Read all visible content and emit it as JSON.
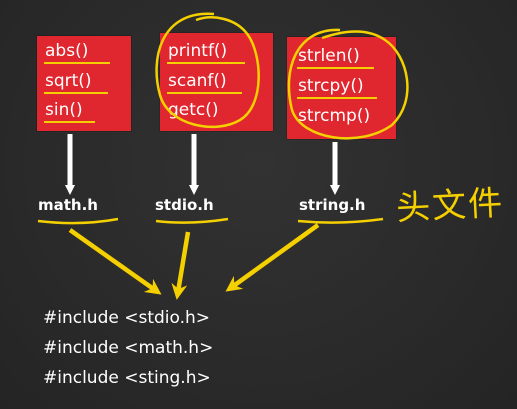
{
  "boxes": [
    {
      "functions": [
        "abs()",
        "sqrt()",
        "sin()"
      ],
      "header": "math.h"
    },
    {
      "functions": [
        "printf()",
        "scanf()",
        "getc()"
      ],
      "header": "stdio.h"
    },
    {
      "functions": [
        "strlen()",
        "strcpy()",
        "strcmp()"
      ],
      "header": "string.h"
    }
  ],
  "handwritten_note": "头文件",
  "includes": [
    "#include <stdio.h>",
    "#include <math.h>",
    "#include <sting.h>"
  ],
  "colors": {
    "background": "#2b2b2b",
    "box_fill": "#e0262f",
    "text": "#ffffff",
    "annotation": "#f5d000"
  }
}
